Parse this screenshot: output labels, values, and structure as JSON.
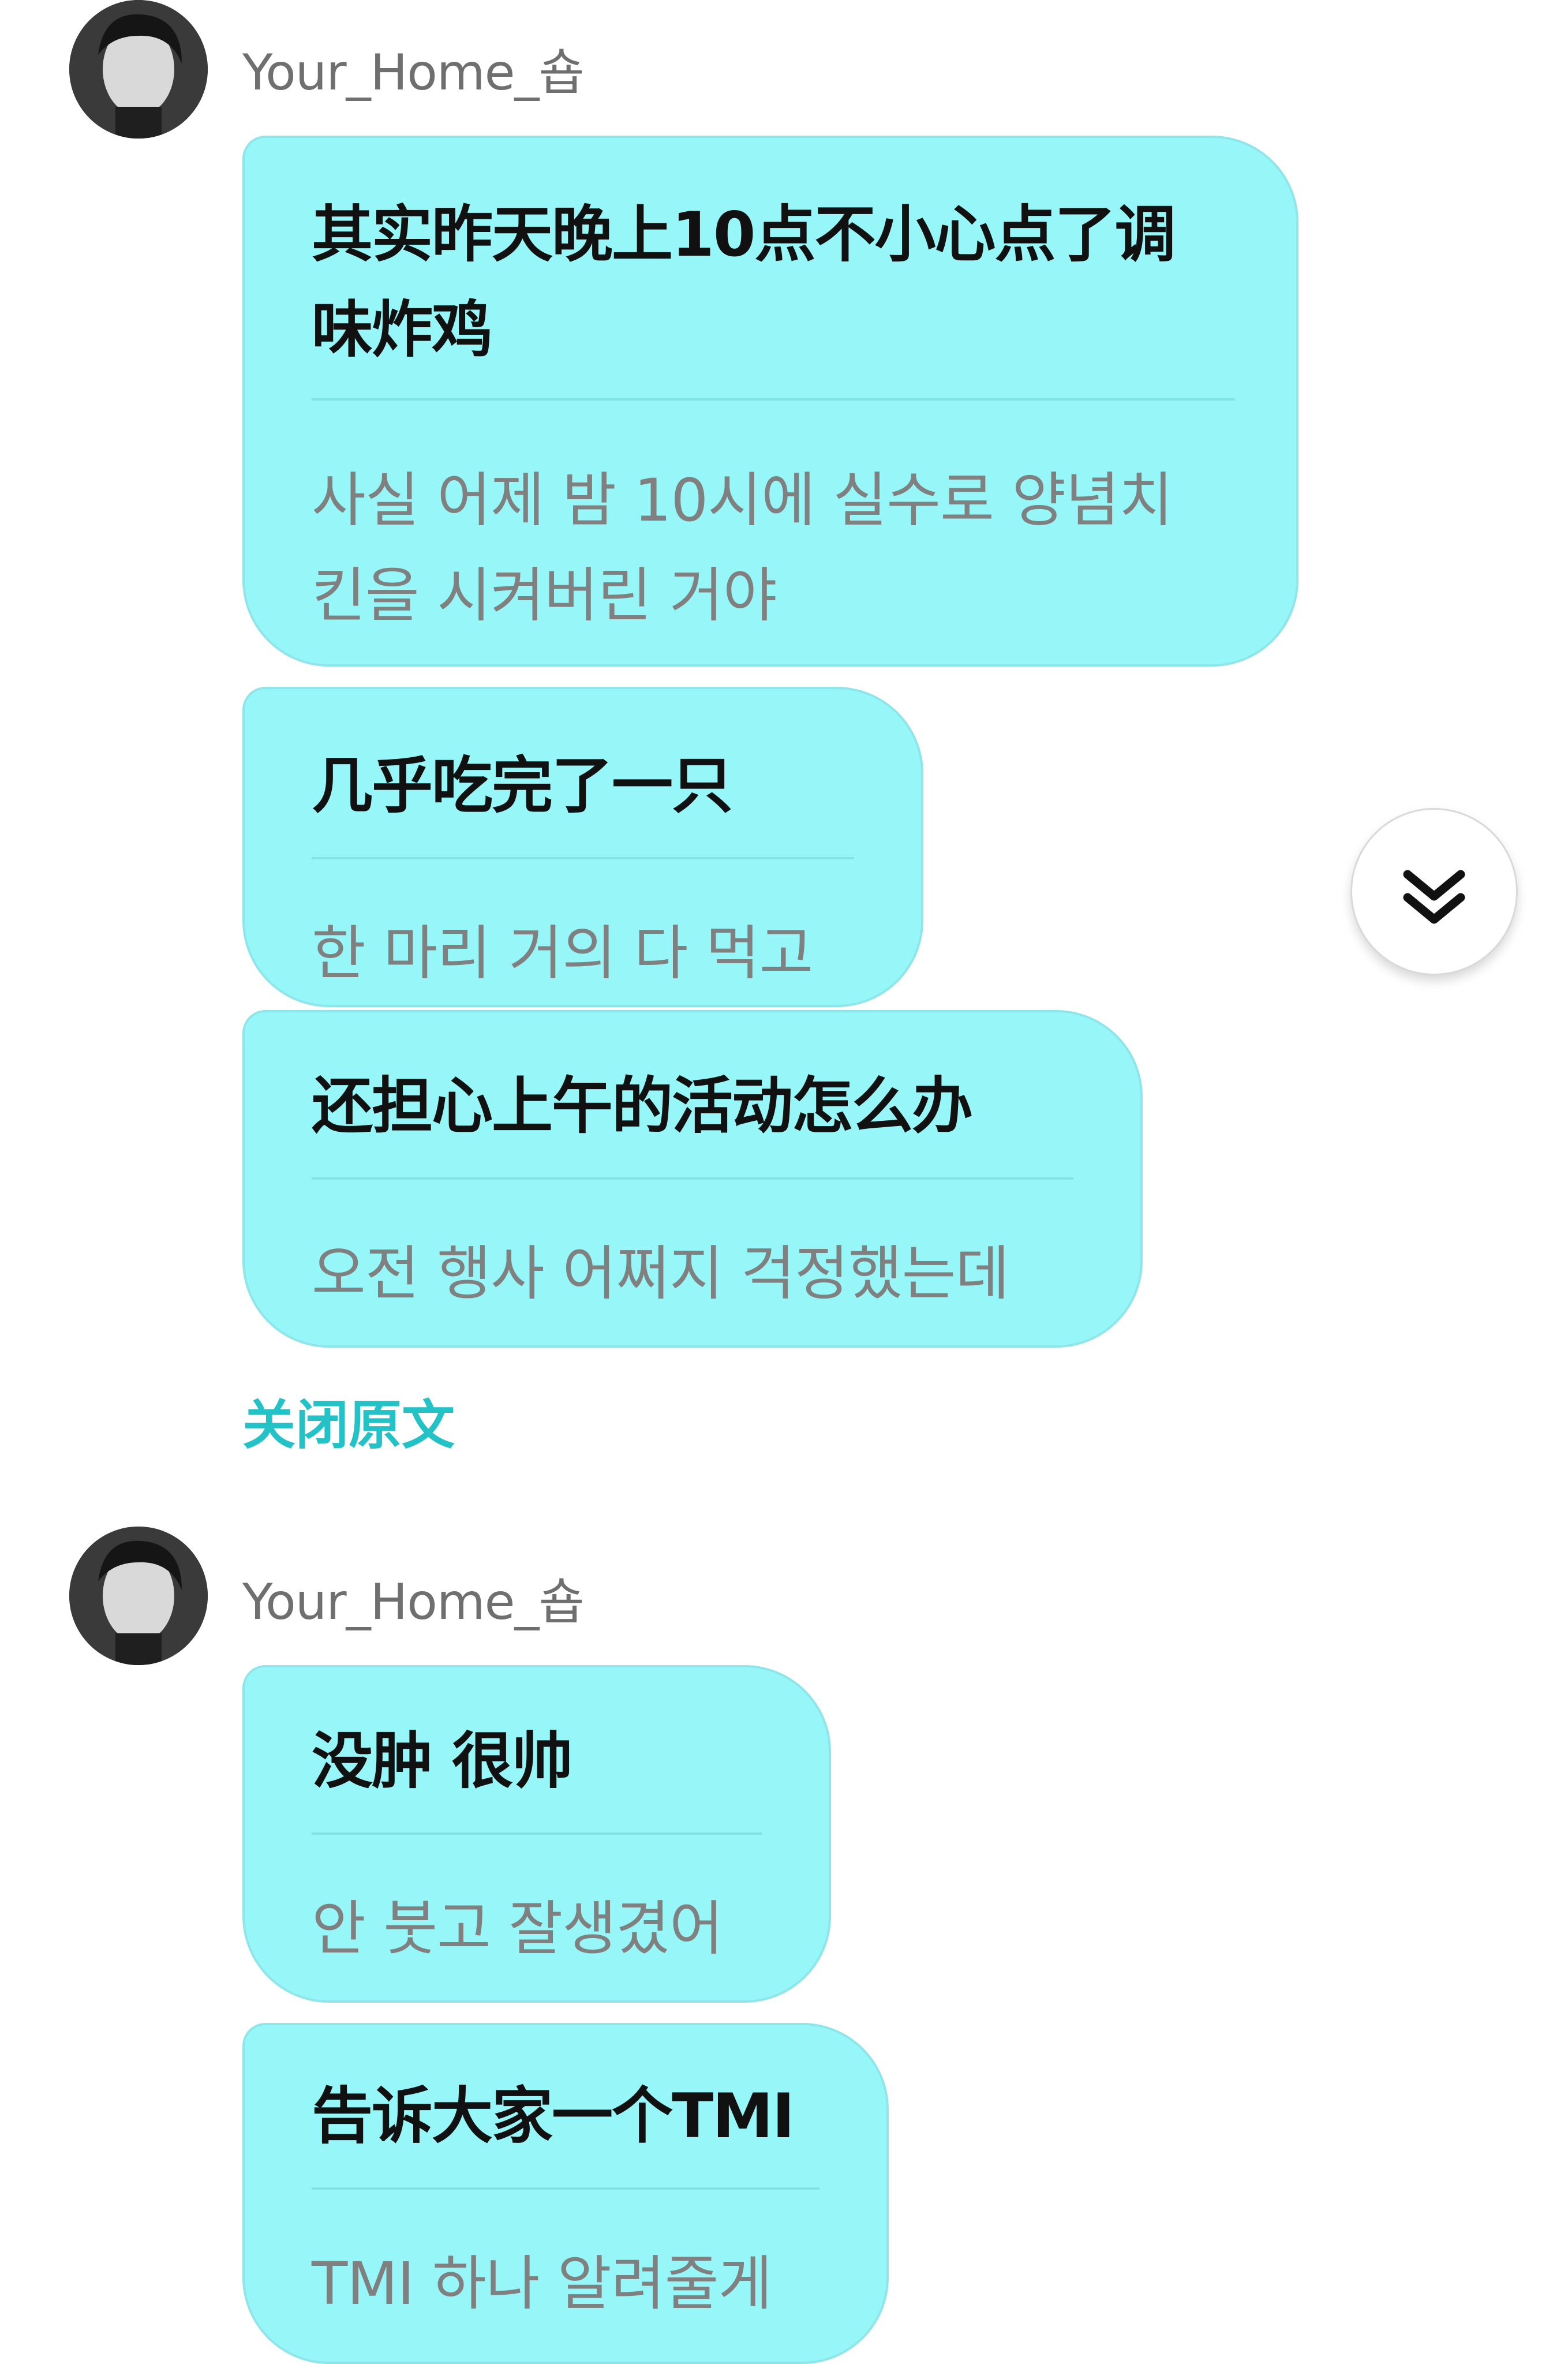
{
  "message_groups": [
    {
      "username": "Your_Home_숍",
      "avatar_icon": "user-avatar",
      "messages": [
        {
          "translated_lines": [
            "其实昨天晚上10点不小心点了调",
            "味炸鸡"
          ],
          "original_lines": [
            "사실 어제 밤 10시에 실수로 양념치",
            "킨을 시켜버린 거야"
          ]
        },
        {
          "translated_lines": [
            "几乎吃完了一只"
          ],
          "original_lines": [
            "한 마리 거의 다 먹고"
          ]
        },
        {
          "translated_lines": [
            "还担心上午的活动怎么办"
          ],
          "original_lines": [
            "오전 행사 어쩌지 걱정했는데"
          ]
        }
      ],
      "toggle_label": "关闭原文"
    },
    {
      "username": "Your_Home_숍",
      "avatar_icon": "user-avatar",
      "messages": [
        {
          "translated_lines": [
            "没肿 很帅"
          ],
          "original_lines": [
            "안 붓고 잘생겼어"
          ]
        },
        {
          "translated_lines": [
            "告诉大家一个TMI"
          ],
          "original_lines": [
            "TMI 하나 알려줄게"
          ]
        }
      ]
    }
  ],
  "scroll_button_icon": "double-chevron-down-icon",
  "colors": {
    "bubble": "#97f6f7",
    "bubble_border": "#8ee6ea",
    "toggle_text": "#22c2c6",
    "translated_text": "#111111",
    "original_text": "#808080",
    "username_text": "#6f6f6f"
  }
}
